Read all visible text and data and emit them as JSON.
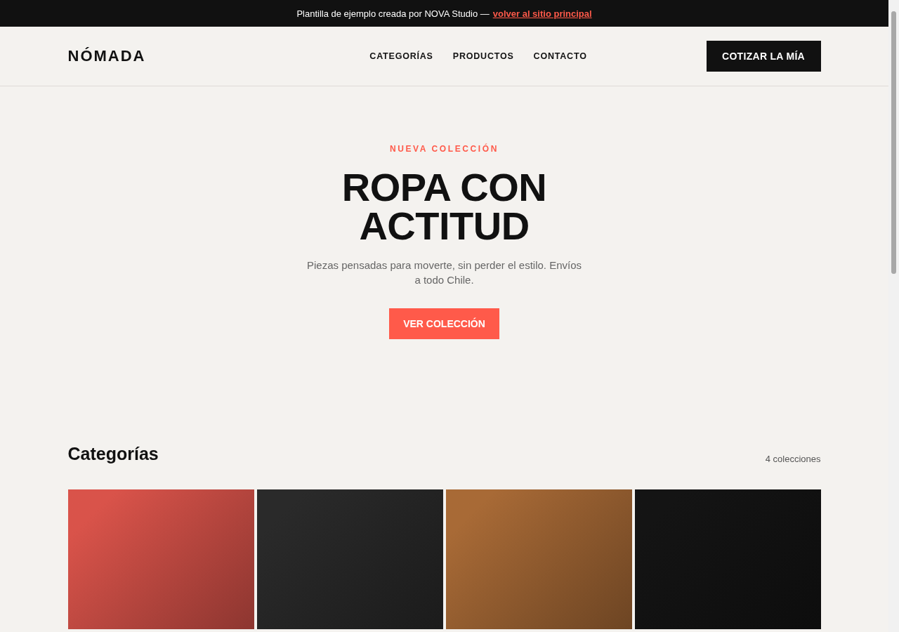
{
  "banner": {
    "text": "Plantilla de ejemplo creada por NOVA Studio —",
    "link": "volver al sitio principal"
  },
  "header": {
    "logo": "NÓMADA",
    "nav": [
      "CATEGORÍAS",
      "PRODUCTOS",
      "CONTACTO"
    ],
    "cta": "COTIZAR LA MÍA"
  },
  "hero": {
    "eyebrow": "NUEVA COLECCIÓN",
    "title_lines": [
      "ROPA CON",
      "ACTITUD"
    ],
    "text": "Piezas pensadas para moverte, sin perder el estilo. Envíos a todo Chile.",
    "button": "VER COLECCIÓN"
  },
  "categories": {
    "title": "Categorías",
    "count": "4 colecciones",
    "tiles": [
      {
        "color": "#d9534a"
      },
      {
        "color": "#2a2a2a"
      },
      {
        "color": "#a86a36"
      },
      {
        "color": "#141414"
      }
    ]
  }
}
